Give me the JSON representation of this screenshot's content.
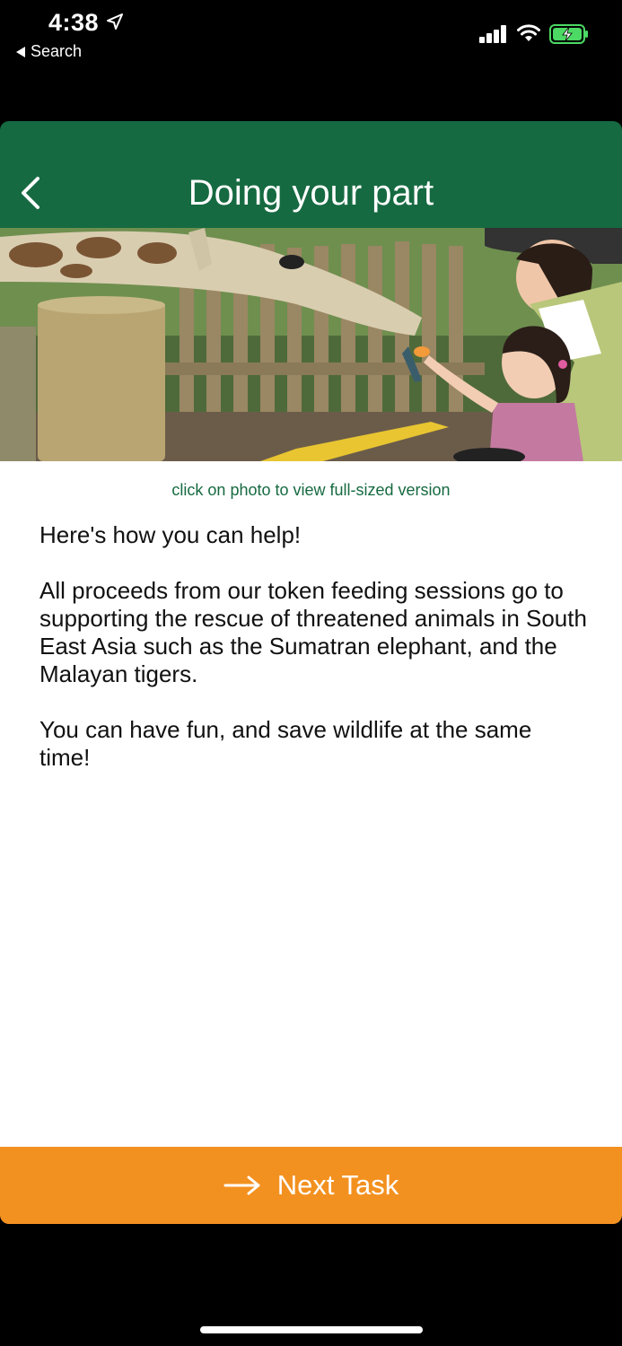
{
  "status_bar": {
    "time": "4:38",
    "back_app_label": "Search",
    "battery_state": "charging",
    "battery_color": "#4cd964"
  },
  "header": {
    "title": "Doing your part",
    "back_icon": "chevron-left-icon",
    "background_color": "#166a41"
  },
  "photo": {
    "subject": "giraffe eating from a child's hand at a zoo feeding platform",
    "hint": "click on photo to view full-sized version"
  },
  "body": {
    "paragraphs": [
      "Here's how you can help!",
      "All proceeds from our token feeding sessions go to supporting the rescue of threatened animals in South East Asia such as the Sumatran elephant, and the Malayan tigers.",
      "You can have fun, and save wildlife at the same time!"
    ]
  },
  "footer_button": {
    "label": "Next Task",
    "icon": "arrow-right-icon",
    "background_color": "#f39120"
  }
}
